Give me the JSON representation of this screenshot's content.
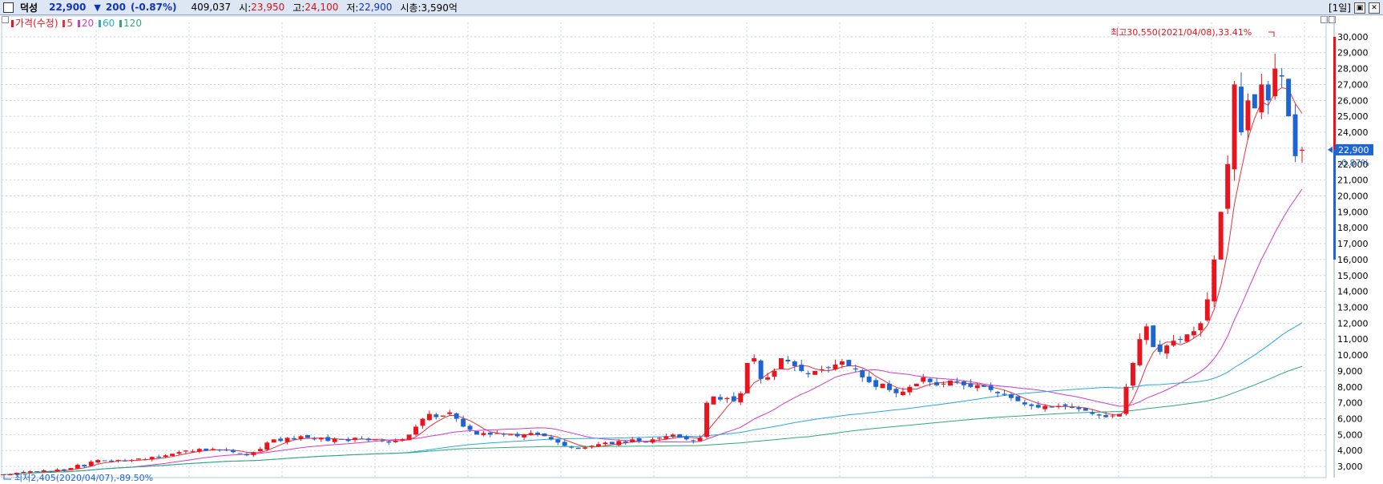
{
  "header": {
    "stock_name": "덕성",
    "price": "22,900",
    "direction": "▼",
    "change": "200",
    "change_pct": "(-0.87%)",
    "volume": "409,037",
    "open_label": "시:",
    "open_value": "23,950",
    "high_label": "고:",
    "high_value": "24,100",
    "low_label": "저:",
    "low_value": "22,900",
    "market_cap": "시총:3,590억",
    "period": "[1일]",
    "close_icon": "close-icon",
    "restore_icon": "restore-icon"
  },
  "legend": {
    "price_label": "가격(수정)",
    "ma5": "5",
    "ma20": "20",
    "ma60": "60",
    "ma120": "120"
  },
  "colors": {
    "up": "#e8141e",
    "down": "#1e64d2",
    "ma5": "#e8323c",
    "ma20": "#d23cc8",
    "ma60": "#28aadc",
    "ma120": "#2daa78",
    "grid": "#c8d2e6",
    "axis": "#1a3c8c"
  },
  "chart_data": {
    "type": "candlestick",
    "title": "",
    "y_axis_ticks": [
      3000,
      4000,
      5000,
      6000,
      7000,
      8000,
      9000,
      10000,
      11000,
      12000,
      13000,
      14000,
      15000,
      16000,
      17000,
      18000,
      19000,
      20000,
      21000,
      22000,
      23000,
      24000,
      25000,
      26000,
      27000,
      28000,
      29000,
      30000
    ],
    "y_tick_labels": [
      "3,000",
      "4,000",
      "5,000",
      "6,000",
      "7,000",
      "8,000",
      "9,000",
      "10,000",
      "11,000",
      "12,000",
      "13,000",
      "14,000",
      "15,000",
      "16,000",
      "17,000",
      "18,000",
      "19,000",
      "20,000",
      "21,000",
      "22,000",
      "23,000",
      "24,000",
      "25,000",
      "26,000",
      "27,000",
      "28,000",
      "29,000",
      "30,000"
    ],
    "ylim": [
      2300,
      30900
    ],
    "current_price_label": "22,900",
    "current_change_label": "-0.87%",
    "current_price": 22900,
    "high_annotation": "최고30,550(2021/04/08),33.41%",
    "low_annotation": "최저2,405(2020/04/07),-89.50%",
    "series_close_approx": [
      2500,
      2500,
      2600,
      2650,
      2700,
      2650,
      2750,
      2700,
      2800,
      2750,
      2900,
      3100,
      3000,
      3300,
      3400,
      3350,
      3300,
      3400,
      3350,
      3400,
      3500,
      3450,
      3600,
      3550,
      3700,
      3800,
      3900,
      4000,
      3950,
      4100,
      4000,
      4100,
      4050,
      4000,
      3900,
      3800,
      3700,
      3900,
      4100,
      4500,
      4700,
      4600,
      4800,
      4700,
      4900,
      4800,
      4700,
      4800,
      4600,
      4750,
      4700,
      4600,
      4800,
      4750,
      4650,
      4700,
      4600,
      4500,
      4600,
      4700,
      5000,
      5500,
      6000,
      6300,
      6100,
      6200,
      6400,
      6000,
      5500,
      5300,
      5000,
      5100,
      5000,
      5100,
      5000,
      5000,
      4900,
      5000,
      5100,
      5000,
      4900,
      4700,
      4500,
      4300,
      4200,
      4100,
      4200,
      4300,
      4400,
      4500,
      4400,
      4600,
      4500,
      4700,
      4600,
      4500,
      4700,
      4800,
      4900,
      5000,
      4800,
      4700,
      4600,
      4800,
      7000,
      7400,
      7200,
      7300,
      7100,
      7600,
      9500,
      9800,
      8500,
      8600,
      9000,
      9800,
      9600,
      9300,
      9000,
      8800,
      9000,
      9100,
      9200,
      9400,
      9600,
      9300,
      9100,
      8600,
      8300,
      8000,
      8200,
      7800,
      7600,
      7700,
      8000,
      8200,
      8600,
      8300,
      8100,
      8200,
      8400,
      8300,
      8100,
      8000,
      8100,
      8000,
      7800,
      7600,
      7500,
      7300,
      7100,
      6900,
      6800,
      6700,
      6800,
      6700,
      6800,
      6800,
      6700,
      6600,
      6500,
      6300,
      6200,
      6100,
      6200,
      6300,
      8000,
      9500,
      11000,
      11800,
      10500,
      10200,
      10600,
      10900,
      11000,
      11300,
      11500,
      12000,
      13500,
      16000,
      19000,
      22000,
      27000,
      24000,
      26000,
      25500,
      27000,
      26000,
      28000,
      27500,
      25000,
      22500,
      22900
    ]
  }
}
